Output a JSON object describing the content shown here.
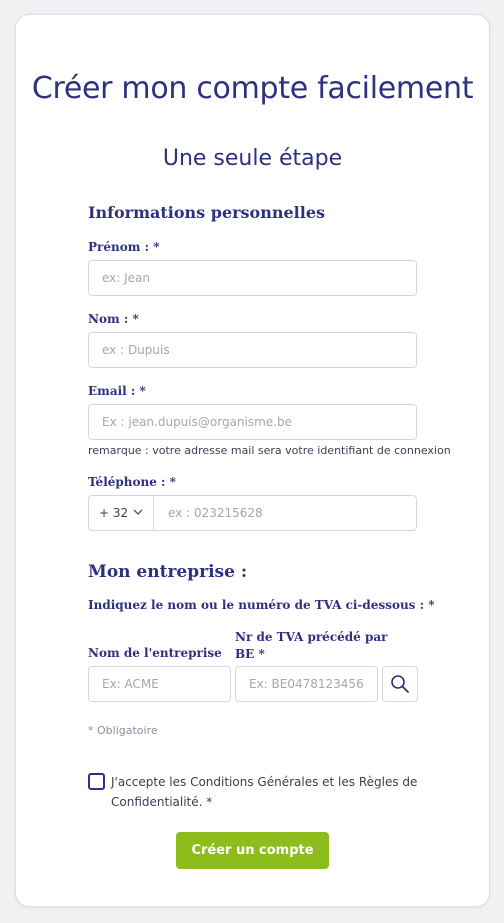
{
  "header": {
    "title": "Créer mon compte facilement",
    "subtitle": "Une seule étape"
  },
  "personal": {
    "section_title": "Informations personnelles",
    "firstname": {
      "label": "Prénom : *",
      "placeholder": "ex: Jean"
    },
    "lastname": {
      "label": "Nom : *",
      "placeholder": "ex : Dupuis"
    },
    "email": {
      "label": "Email : *",
      "placeholder": "Ex : jean.dupuis@organisme.be",
      "note": "remarque : votre adresse mail sera votre identifiant de connexion"
    },
    "phone": {
      "label": "Téléphone : *",
      "prefix": "+ 32",
      "placeholder": "ex : 023215628"
    }
  },
  "company": {
    "section_title": "Mon entreprise :",
    "instruction": "Indiquez le nom ou le numéro de TVA ci-dessous : *",
    "name": {
      "label": "Nom de l'entreprise",
      "placeholder": "Ex: ACME"
    },
    "vat": {
      "label_line1": "Nr de TVA précédé par",
      "label_line2": "BE *",
      "placeholder": "Ex: BE0478123456"
    },
    "search_icon": "search-icon"
  },
  "required_note": "* Obligatoire",
  "terms": {
    "text_line1": "J'accepte les Conditions Générales et les Règles de",
    "text_line2": "Confidentialité. *",
    "checked": false
  },
  "submit_label": "Créer un compte",
  "colors": {
    "title": "#2e3080",
    "accent_button": "#8dbd1d",
    "border": "#d6d7de",
    "background": "#f1f1f4"
  }
}
